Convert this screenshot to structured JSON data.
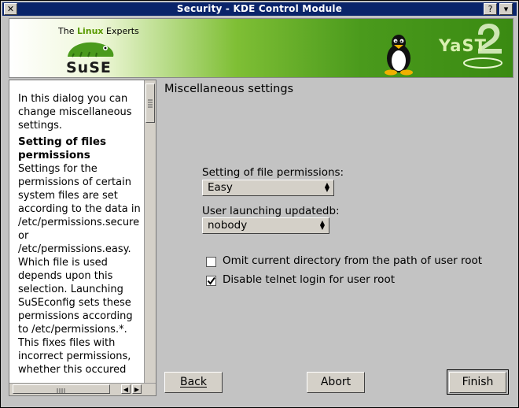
{
  "window": {
    "title": "Security - KDE Control Module",
    "menu_glyph": "✕",
    "help_glyph": "?",
    "minimize_glyph": "▾"
  },
  "banner": {
    "tagline_pre": "The ",
    "tagline_brand": "Linux",
    "tagline_post": " Experts",
    "logo_text": "SuSE",
    "yast_text": "YaST"
  },
  "help": {
    "intro": "In this dialog you can change miscellaneous settings.",
    "heading": "Setting of files permissions",
    "body": "Settings for the permissions of certain system files are set according to the data in /etc/permissions.secure or /etc/permissions.easy. Which file is used depends upon this selection. Launching SuSEconfig sets these permissions according to /etc/permissions.*. This fixes files with incorrect permissions, whether this occured"
  },
  "main": {
    "section_title": "Miscellaneous settings",
    "file_perm_label": "Setting of file permissions:",
    "file_perm_value": "Easy",
    "updatedb_label": "User launching updatedb:",
    "updatedb_value": "nobody",
    "checkbox_1_label": "Omit current directory from the path of user root",
    "checkbox_1_checked": false,
    "checkbox_2_label": "Disable telnet login for user root",
    "checkbox_2_checked": true
  },
  "buttons": {
    "back": "Back",
    "abort": "Abort",
    "finish": "Finish"
  }
}
